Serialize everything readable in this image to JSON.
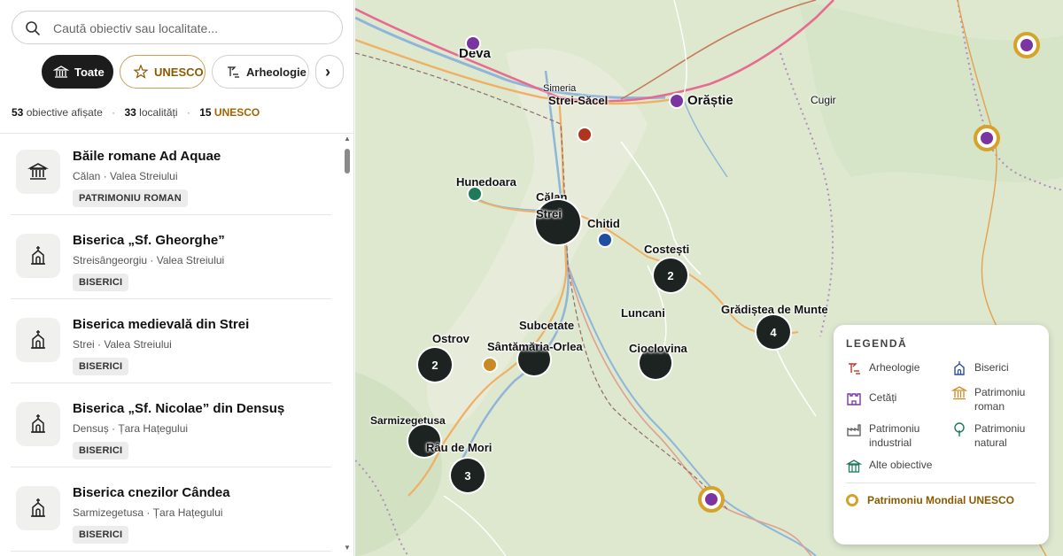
{
  "search": {
    "placeholder": "Caută obiectiv sau localitate..."
  },
  "filters": {
    "all": "Toate",
    "unesco": "UNESCO",
    "archaeology": "Arheologie",
    "more": "›"
  },
  "stats": {
    "objectives_count": "53",
    "objectives_label": "obiective afișate",
    "localities_count": "33",
    "localities_label": "localități",
    "unesco_count": "15",
    "unesco_label": "UNESCO"
  },
  "list": [
    {
      "title": "Băile romane Ad Aquae",
      "subtitle": "Călan · Valea Streiului",
      "tag": "PATRIMONIU ROMAN",
      "icon": "roman-heritage-icon"
    },
    {
      "title": "Biserica „Sf. Gheorghe”",
      "subtitle": "Streisângeorgiu · Valea Streiului",
      "tag": "BISERICI",
      "icon": "church-icon"
    },
    {
      "title": "Biserica medievală din Strei",
      "subtitle": "Strei · Valea Streiului",
      "tag": "BISERICI",
      "icon": "church-icon"
    },
    {
      "title": "Biserica „Sf. Nicolae” din Densuș",
      "subtitle": "Densuș · Țara Hațegului",
      "tag": "BISERICI",
      "icon": "church-icon"
    },
    {
      "title": "Biserica cnezilor Cândea",
      "subtitle": "Sarmizegetusa · Țara Hațegului",
      "tag": "BISERICI",
      "icon": "church-icon"
    }
  ],
  "map": {
    "places": {
      "deva": "Deva",
      "simeria": "Simeria",
      "strei_sacel": "Strei-Săcel",
      "orastie": "Orăștie",
      "cugir": "Cugir",
      "hunedoara": "Hunedoara",
      "calan": "Călan",
      "strei": "Strei",
      "chitid": "Chitid",
      "costesti": "Costești",
      "luncani": "Luncani",
      "gradistea": "Grădiștea de Munte",
      "ostrov": "Ostrov",
      "subcetate": "Subcetate",
      "santamaria": "Sântămăria-Orlea",
      "cioclovina": "Cioclovina",
      "sarmizegetusa": "Sarmizegetusa",
      "rau_de_mori": "Râu de Mori"
    },
    "clusters": {
      "costesti": "2",
      "gradistea": "4",
      "ostrov": "2",
      "rau_de_mori": "3"
    },
    "colors": {
      "purple": "#7a35a0",
      "teal": "#1e7a5a",
      "blue": "#1f4fa0",
      "red": "#b0341f",
      "orange": "#c98a26",
      "unesco_ring": "#d6a32a"
    }
  },
  "legend": {
    "title": "LEGENDĂ",
    "items": [
      {
        "label": "Arheologie",
        "icon": "archaeology-icon",
        "color": "#c0392b"
      },
      {
        "label": "Biserici",
        "icon": "church-icon",
        "color": "#2c4f9e"
      },
      {
        "label": "Cetăți",
        "icon": "fortress-icon",
        "color": "#7a35a0"
      },
      {
        "label": "Patrimoniu roman",
        "icon": "roman-heritage-icon",
        "color": "#c98a26"
      },
      {
        "label": "Patrimoniu industrial",
        "icon": "industrial-icon",
        "color": "#555555"
      },
      {
        "label": "Patrimoniu natural",
        "icon": "tree-icon",
        "color": "#1e7a5a"
      },
      {
        "label": "Alte obiective",
        "icon": "building-icon",
        "color": "#1e7a5a"
      }
    ],
    "unesco": "Patrimoniu Mondial UNESCO"
  }
}
